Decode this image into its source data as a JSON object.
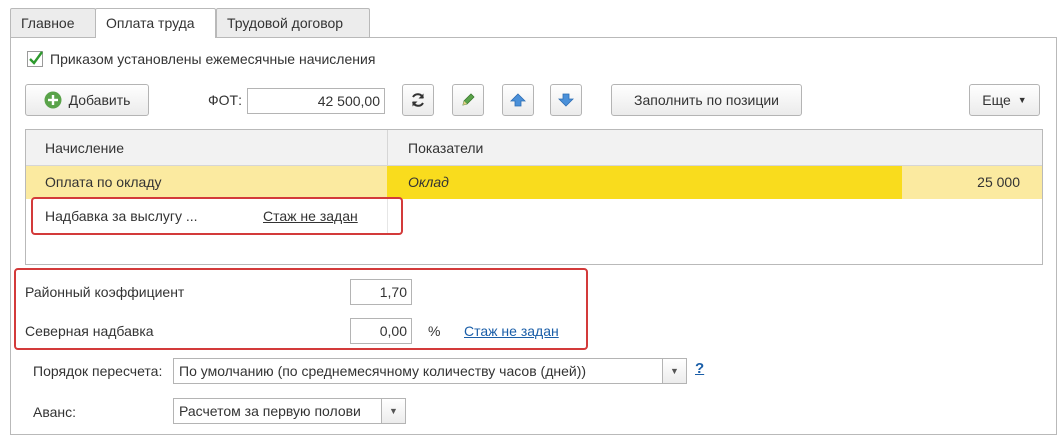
{
  "tabs": [
    {
      "label": "Главное"
    },
    {
      "label": "Оплата труда"
    },
    {
      "label": "Трудовой договор"
    }
  ],
  "monthly_accruals_checkbox": {
    "label": "Приказом установлены ежемесячные начисления",
    "checked": true
  },
  "toolbar": {
    "add_label": "Добавить",
    "fot_label": "ФОТ:",
    "fot_value": "42 500,00",
    "fill_by_position_label": "Заполнить по позиции",
    "more_label": "Еще",
    "icons": [
      "refresh-icon",
      "edit-pencil-icon",
      "move-up-icon",
      "move-down-icon"
    ]
  },
  "accruals_table": {
    "columns": [
      "Начисление",
      "Показатели"
    ],
    "rows": [
      {
        "accrual": "Оплата по окладу",
        "indicator": "Оклад",
        "value": "25 000"
      },
      {
        "accrual": "Надбавка за выслугу ...",
        "indicator_link": "Стаж не задан"
      }
    ]
  },
  "regional_coefficient": {
    "label": "Районный коэффициент",
    "value": "1,70"
  },
  "northern_allowance": {
    "label": "Северная надбавка",
    "value": "0,00",
    "unit": "%",
    "link": "Стаж не задан"
  },
  "recalc_order": {
    "label": "Порядок пересчета:",
    "value": "По умолчанию (по среднемесячному количеству часов (дней))",
    "help": "?"
  },
  "advance": {
    "label": "Аванс:",
    "value": "Расчетом за первую полови"
  },
  "colors": {
    "selected_row": "#f9dc1d",
    "selected_row_light": "#fbeaa0",
    "highlight_border": "#d33a3a",
    "link": "#1a5ea8"
  }
}
